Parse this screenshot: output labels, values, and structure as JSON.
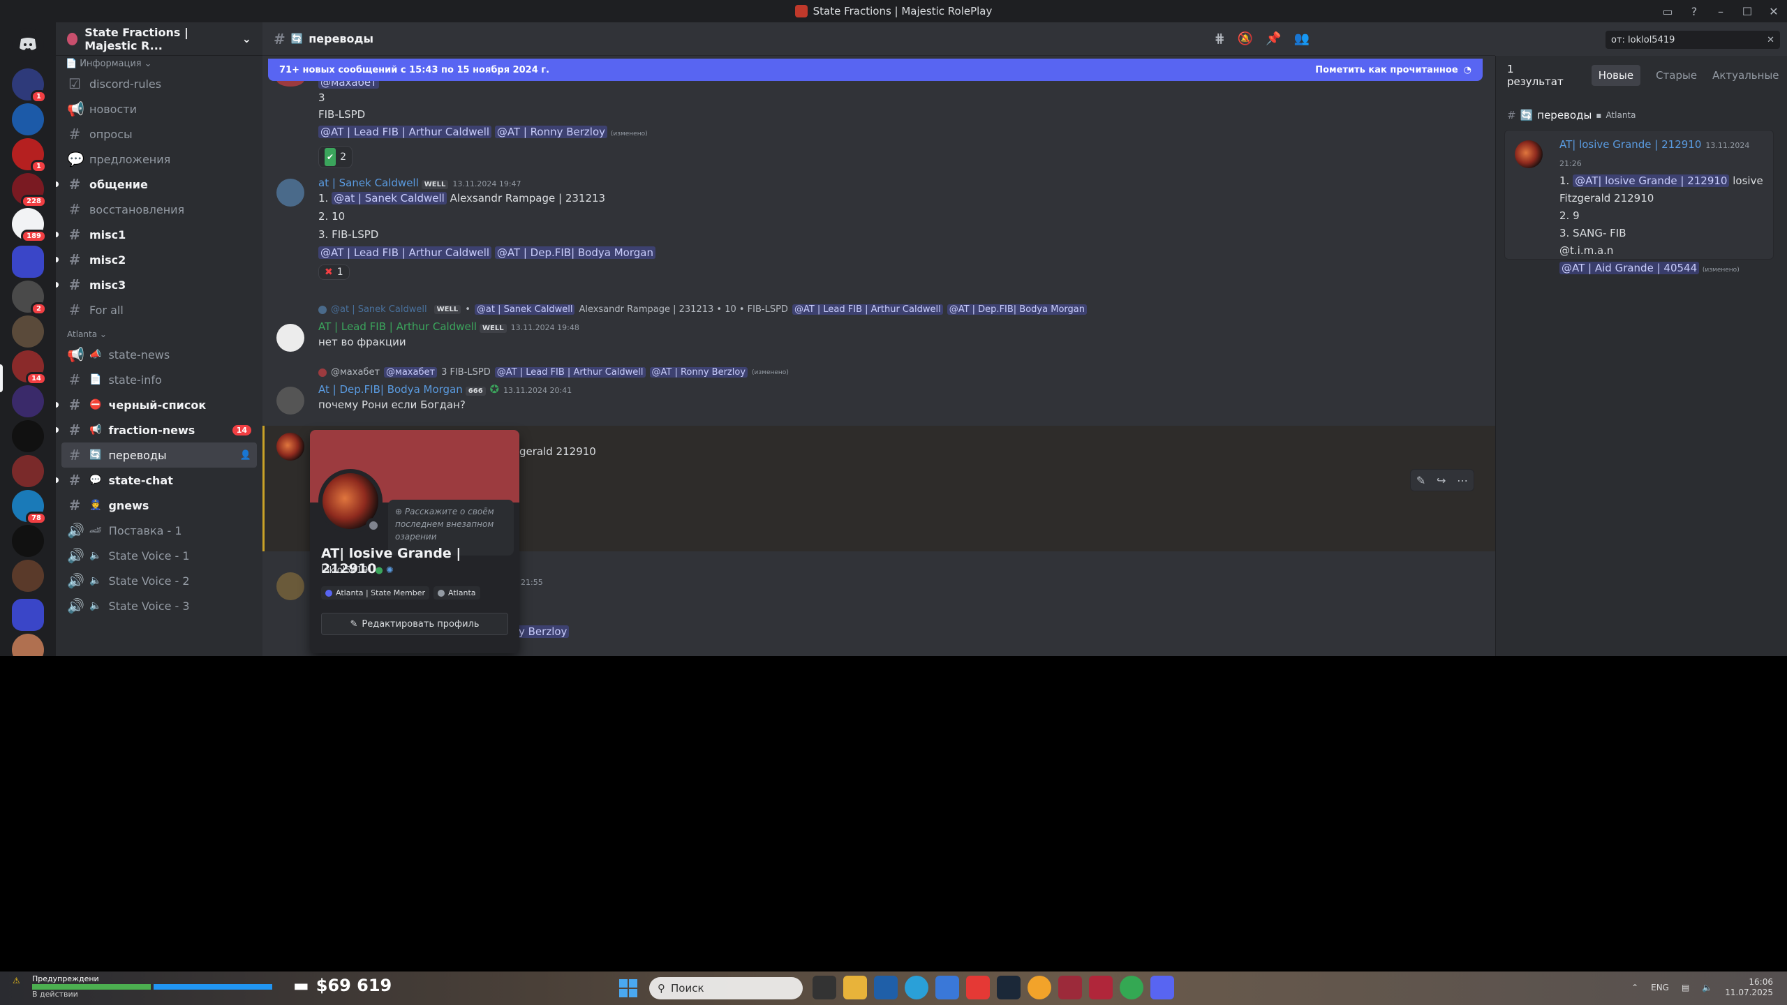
{
  "window": {
    "title": "State Fractions | Majestic RolePlay"
  },
  "rail": {
    "badges": [
      "1",
      "1",
      "228",
      "189",
      "2",
      "14",
      "78"
    ]
  },
  "guild": {
    "name": "State Fractions | Majestic R...",
    "info_label": "Информация"
  },
  "channels": [
    {
      "name": "discord-rules",
      "kind": "rules",
      "unread": false
    },
    {
      "name": "новости",
      "kind": "announce",
      "unread": false
    },
    {
      "name": "опросы",
      "kind": "text",
      "unread": false
    },
    {
      "name": "предложения",
      "kind": "forum",
      "unread": false
    },
    {
      "name": "общение",
      "kind": "text",
      "unread": true
    },
    {
      "name": "восстановления",
      "kind": "text",
      "unread": false
    },
    {
      "name": "misc1",
      "kind": "text",
      "unread": true
    },
    {
      "name": "misc2",
      "kind": "text",
      "unread": true
    },
    {
      "name": "misc3",
      "kind": "text",
      "unread": true
    },
    {
      "name": "For all",
      "kind": "text",
      "unread": false
    }
  ],
  "category_atlanta": "Atlanta",
  "atlanta_channels": [
    {
      "name": "state-news",
      "emoji": "📣",
      "unread": false,
      "badge": ""
    },
    {
      "name": "state-info",
      "emoji": "📄",
      "unread": false,
      "badge": ""
    },
    {
      "name": "черный-список",
      "emoji": "⛔",
      "unread": true,
      "badge": ""
    },
    {
      "name": "fraction-news",
      "emoji": "📢",
      "unread": true,
      "badge": "14"
    },
    {
      "name": "переводы",
      "emoji": "🔄",
      "unread": true,
      "badge": "",
      "active": true
    },
    {
      "name": "state-chat",
      "emoji": "💬",
      "unread": true,
      "badge": ""
    },
    {
      "name": "gnews",
      "emoji": "👮",
      "unread": true,
      "badge": ""
    },
    {
      "name": "Поставка - 1",
      "emoji": "🏎",
      "unread": false,
      "badge": "",
      "voice": true
    },
    {
      "name": "State Voice - 1",
      "emoji": "🔊",
      "unread": false,
      "badge": "",
      "voice": true
    },
    {
      "name": "State Voice - 2",
      "emoji": "🔊",
      "unread": false,
      "badge": "",
      "voice": true
    },
    {
      "name": "State Voice - 3",
      "emoji": "🔊",
      "unread": false,
      "badge": "",
      "voice": true
    }
  ],
  "header": {
    "channel": "переводы"
  },
  "search": {
    "query": "от: loklol5419"
  },
  "new_bar": {
    "text": "71+ новых сообщений с 15:43 по 15 ноября 2024 г.",
    "mark_read": "Пометить как прочитанное"
  },
  "messages": {
    "m0": {
      "mention_top": "@махабет",
      "line1": "3",
      "line2": "FIB-LSPD",
      "mention1": "@AT | Lead FIB | Arthur Caldwell",
      "mention2": "@AT | Ronny Berzloy",
      "edited": "(изменено)",
      "reaction_count": "2"
    },
    "m1": {
      "author": "at | Sanek Caldwell",
      "tag": "WELL",
      "time": "13.11.2024 19:47",
      "l1_prefix": "1.",
      "l1_mention": "@at | Sanek Caldwell",
      "l1_text": "Alexsandr Rampage | 231213",
      "l2": "2. 10",
      "l3": "3. FIB-LSPD",
      "mention1": "@AT | Lead FIB | Arthur Caldwell",
      "mention2": "@AT | Dep.FIB| Bodya Morgan",
      "reaction_count": "1"
    },
    "m2": {
      "reply_author": "@at | Sanek Caldwell",
      "reply_tag": "WELL",
      "reply_mention": "@at | Sanek Caldwell",
      "reply_text": "Alexsandr Rampage | 231213  • 10  • FIB-LSPD",
      "reply_mention2": "@AT | Lead FIB | Arthur Caldwell",
      "reply_mention3": "@AT | Dep.FIB| Bodya Morgan",
      "author": "AT | Lead FIB | Arthur Caldwell",
      "tag": "WELL",
      "time": "13.11.2024 19:48",
      "text": "нет во фракции"
    },
    "m3": {
      "reply_author": "@махабет",
      "reply_mention": "@махабет",
      "reply_text": "3 FIB-LSPD",
      "reply_mention2": "@AT | Lead FIB | Arthur Caldwell",
      "reply_mention3": "@AT | Ronny Berzloy",
      "reply_edited": "(изменено)",
      "author": "At | Dep.FIB| Bodya Morgan",
      "tag": "666",
      "time": "13.11.2024 20:41",
      "text": "почему Рони если Богдан?"
    },
    "m4": {
      "text_visible": "gerald 212910"
    },
    "m5": {
      "time_fragment": "21:55",
      "mention_fragment": "y Berzloy"
    }
  },
  "popout": {
    "note_placeholder": "Расскажите о своём последнем внезапном озарении",
    "display_name": "AT| losive Grande | 212910",
    "username": "loklol5419",
    "roles": [
      {
        "name": "Atlanta | State Member",
        "color": "#5865f2"
      },
      {
        "name": "Atlanta",
        "color": "#949ba4"
      }
    ],
    "edit_button": "Редактировать профиль"
  },
  "search_panel": {
    "count": "1 результат",
    "tabs": [
      "Новые",
      "Старые",
      "Актуальные"
    ],
    "channel": "переводы",
    "folder": "Atlanta",
    "result": {
      "author": "AT| losive Grande | 212910",
      "time": "13.11.2024 21:26",
      "l1_prefix": "1.",
      "l1_mention": "@AT| losive Grande | 212910",
      "l1_text": "losive Fitzgerald 212910",
      "l2": "2. 9",
      "l3": "3. SANG- FIB",
      "l4": "@t.i.m.a.n",
      "mention": "@AT | Aid Grande | 40544",
      "edited": "(изменено)"
    }
  },
  "taskbar": {
    "warning": "Предупреждени",
    "warning2": "В действии",
    "money": "$69 619",
    "search_placeholder": "Поиск",
    "lang": "ENG",
    "time": "16:06",
    "date": "11.07.2025"
  }
}
